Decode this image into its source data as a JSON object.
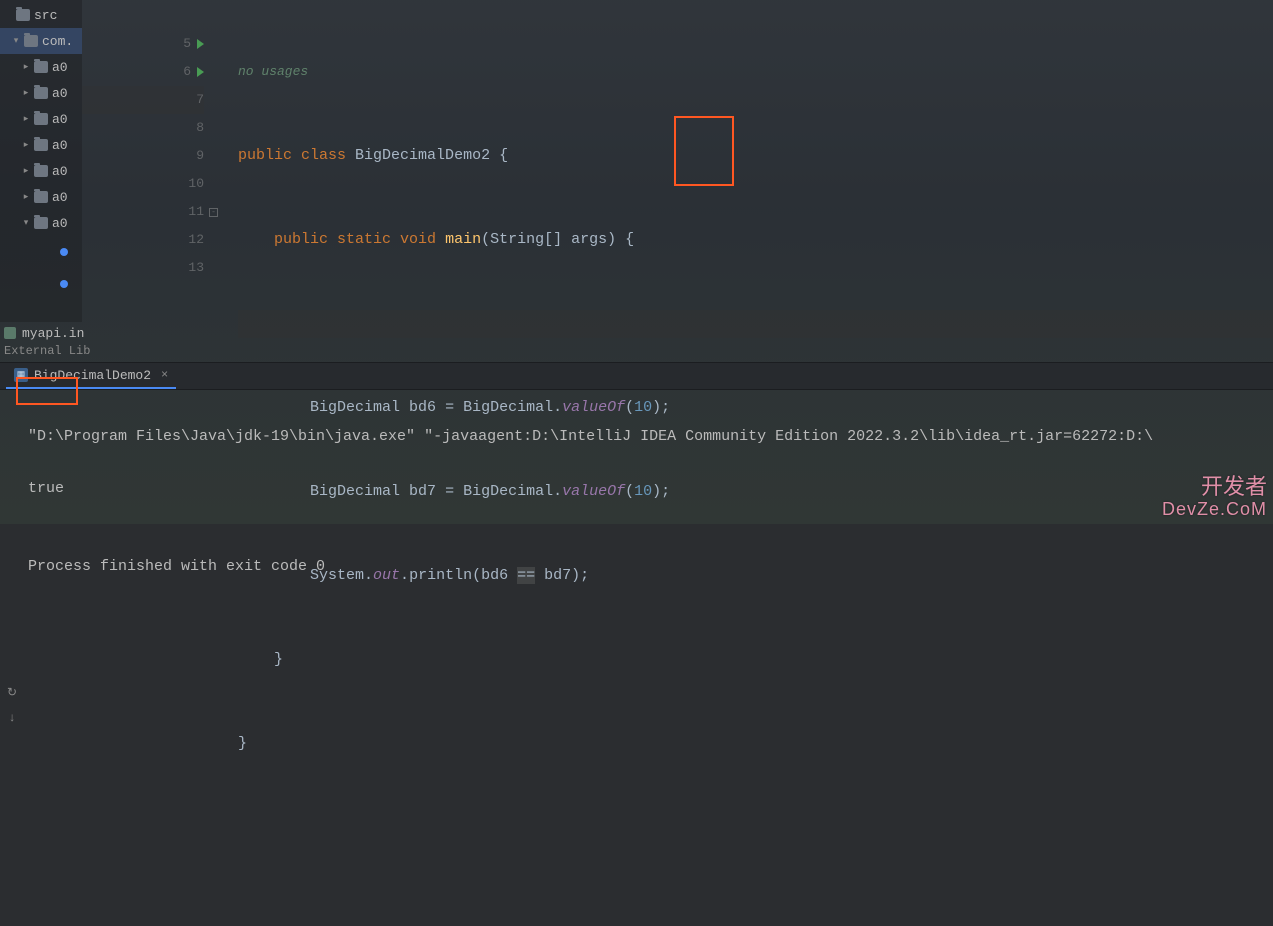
{
  "sidebar": {
    "items": [
      {
        "label": "src",
        "expanded": false
      },
      {
        "label": "com.",
        "expanded": true
      },
      {
        "label": "a0"
      },
      {
        "label": "a0"
      },
      {
        "label": "a0"
      },
      {
        "label": "a0"
      },
      {
        "label": "a0"
      },
      {
        "label": "a0"
      },
      {
        "label": "a0",
        "expanded": true
      }
    ],
    "myapi": "myapi.in",
    "external": "External Lib"
  },
  "editor": {
    "hint": "no usages",
    "lines": {
      "5": {
        "kw1": "public class",
        "cls": "BigDecimalDemo2",
        "brace": " {"
      },
      "6": {
        "kw1": "public static void",
        "mth": "main",
        "args": "(String[] args) {"
      },
      "7": "",
      "8": {
        "type": "BigDecimal",
        "var": "bd6",
        "eq": " = ",
        "cls2": "BigDecimal",
        "dot": ".",
        "vmth": "valueOf",
        "open": "(",
        "num": "10",
        "close": ");"
      },
      "9": {
        "type": "BigDecimal",
        "var": "bd7",
        "eq": " = ",
        "cls2": "BigDecimal",
        "dot": ".",
        "vmth": "valueOf",
        "open": "(",
        "num": "10",
        "close": ");"
      },
      "10": {
        "sys": "System.",
        "out": "out",
        "dot2": ".",
        "pln": "println",
        "args2": "(bd6 ",
        "op": "==",
        "args3": " bd7);"
      },
      "11": "    }",
      "12": "}",
      "13": ""
    },
    "gutterNumbers": [
      "5",
      "6",
      "7",
      "8",
      "9",
      "10",
      "11",
      "12",
      "13"
    ]
  },
  "runTab": {
    "label": "BigDecimalDemo2",
    "close": "×"
  },
  "console": {
    "cmd": "\"D:\\Program Files\\Java\\jdk-19\\bin\\java.exe\" \"-javaagent:D:\\IntelliJ IDEA Community Edition 2022.3.2\\lib\\idea_rt.jar=62272:D:\\",
    "output": "true",
    "blank": "",
    "exit": "Process finished with exit code 0"
  },
  "watermark": {
    "line1": "开发者",
    "line2": "DevZe.CoM"
  }
}
